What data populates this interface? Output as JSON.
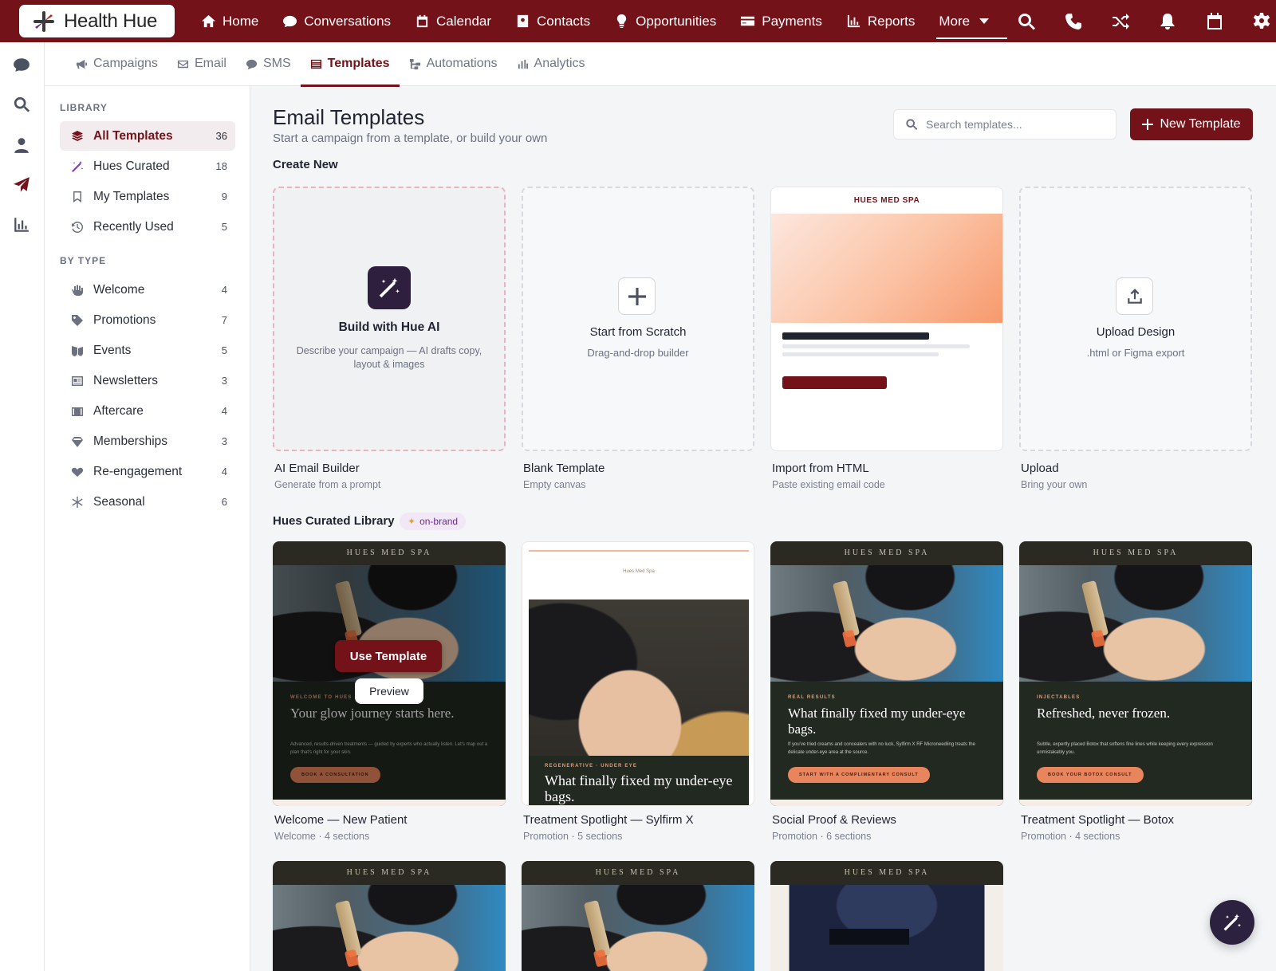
{
  "app": {
    "name": "Health Hue",
    "brand_color": "#741219",
    "accent_color": "#2d2140"
  },
  "topnav": {
    "items": [
      {
        "label": "Home",
        "icon": "home-icon"
      },
      {
        "label": "Conversations",
        "icon": "chat-icon"
      },
      {
        "label": "Calendar",
        "icon": "calendar-icon"
      },
      {
        "label": "Contacts",
        "icon": "contact-card-icon"
      },
      {
        "label": "Opportunities",
        "icon": "lightbulb-icon"
      },
      {
        "label": "Payments",
        "icon": "credit-card-icon"
      },
      {
        "label": "Reports",
        "icon": "bar-chart-icon"
      }
    ],
    "more_label": "More",
    "actions": [
      "search-icon",
      "phone-icon",
      "shuffle-icon",
      "bell-icon",
      "calendar-icon",
      "gear-icon"
    ]
  },
  "rail": [
    "chat-icon",
    "search-icon",
    "user-icon",
    "paper-plane-icon",
    "bar-chart-icon"
  ],
  "subnav": {
    "items": [
      {
        "label": "Campaigns",
        "icon": "megaphone-icon"
      },
      {
        "label": "Email",
        "icon": "envelope-icon"
      },
      {
        "label": "SMS",
        "icon": "sms-icon"
      },
      {
        "label": "Templates",
        "icon": "template-icon",
        "active": true
      },
      {
        "label": "Automations",
        "icon": "flow-icon"
      },
      {
        "label": "Analytics",
        "icon": "bar-chart-icon"
      }
    ]
  },
  "sidebar": {
    "library_heading": "LIBRARY",
    "library": [
      {
        "label": "All Templates",
        "count": "36",
        "icon": "layers-icon",
        "active": true
      },
      {
        "label": "Hues Curated",
        "count": "18",
        "icon": "magic-wand-icon"
      },
      {
        "label": "My Templates",
        "count": "9",
        "icon": "bookmark-icon"
      },
      {
        "label": "Recently Used",
        "count": "5",
        "icon": "history-icon"
      }
    ],
    "type_heading": "BY TYPE",
    "types": [
      {
        "label": "Welcome",
        "count": "4",
        "icon": "wave-hand-icon"
      },
      {
        "label": "Promotions",
        "count": "7",
        "icon": "tag-icon"
      },
      {
        "label": "Events",
        "count": "5",
        "icon": "mask-icon"
      },
      {
        "label": "Newsletters",
        "count": "3",
        "icon": "newspaper-icon"
      },
      {
        "label": "Aftercare",
        "count": "4",
        "icon": "medical-kit-icon"
      },
      {
        "label": "Memberships",
        "count": "3",
        "icon": "gem-icon"
      },
      {
        "label": "Re-engagement",
        "count": "4",
        "icon": "heart-refresh-icon"
      },
      {
        "label": "Seasonal",
        "count": "6",
        "icon": "snowflake-icon"
      }
    ]
  },
  "main": {
    "title": "Email Templates",
    "subtitle": "Start a campaign from a template, or build your own",
    "search_placeholder": "Search templates...",
    "new_button": "New Template",
    "create_heading": "Create New",
    "create_cards": [
      {
        "title": "Build with Hue AI",
        "desc": "Describe your campaign — AI drafts copy, layout & images",
        "name": "AI Email Builder",
        "meta": "Generate from a prompt"
      },
      {
        "title": "Start from Scratch",
        "desc": "Drag-and-drop builder",
        "name": "Blank Template",
        "meta": "Empty canvas"
      },
      {
        "title": "HUES MED SPA",
        "name": "Import from HTML",
        "meta": "Paste existing email code"
      },
      {
        "title": "Upload Design",
        "desc": ".html or Figma export",
        "name": "Upload",
        "meta": "Bring your own"
      }
    ],
    "library_heading": "Hues Curated Library",
    "library_badge": "on-brand",
    "templates": [
      {
        "name": "Welcome — New Patient",
        "meta": "Welcome · 4 sections",
        "brand": "HUES MED SPA",
        "kicker": "WELCOME TO HUES",
        "headline": "Your glow journey starts here.",
        "copy": "Advanced, results-driven treatments — guided by experts who actually listen. Let's map out a plan that's right for your skin.",
        "cta": "BOOK A CONSULTATION",
        "use_label": "Use Template",
        "preview_label": "Preview"
      },
      {
        "name": "Treatment Spotlight — Sylfirm X",
        "meta": "Promotion · 5 sections",
        "brand": "Hues Med Spa",
        "kicker": "REGENERATIVE · UNDER EYE",
        "headline": "What finally fixed my under-eye bags."
      },
      {
        "name": "Social Proof & Reviews",
        "meta": "Promotion · 6 sections",
        "brand": "HUES MED SPA",
        "kicker": "REAL RESULTS",
        "headline": "What finally fixed my under-eye bags.",
        "copy": "If you've tried creams and concealers with no luck, Sylfirm X RF Microneedling treats the delicate under-eye area at the source.",
        "cta": "START WITH A COMPLIMENTARY CONSULT"
      },
      {
        "name": "Treatment Spotlight — Botox",
        "meta": "Promotion · 4 sections",
        "brand": "HUES MED SPA",
        "kicker": "INJECTABLES",
        "headline": "Refreshed, never frozen.",
        "copy": "Subtle, expertly placed Botox that softens fine lines while keeping every expression unmistakably you.",
        "cta": "BOOK YOUR BOTOX CONSULT"
      }
    ],
    "more_templates": [
      {
        "brand": "HUES MED SPA"
      },
      {
        "brand": "HUES MED SPA"
      },
      {
        "brand": "HUES MED SPA"
      }
    ]
  }
}
